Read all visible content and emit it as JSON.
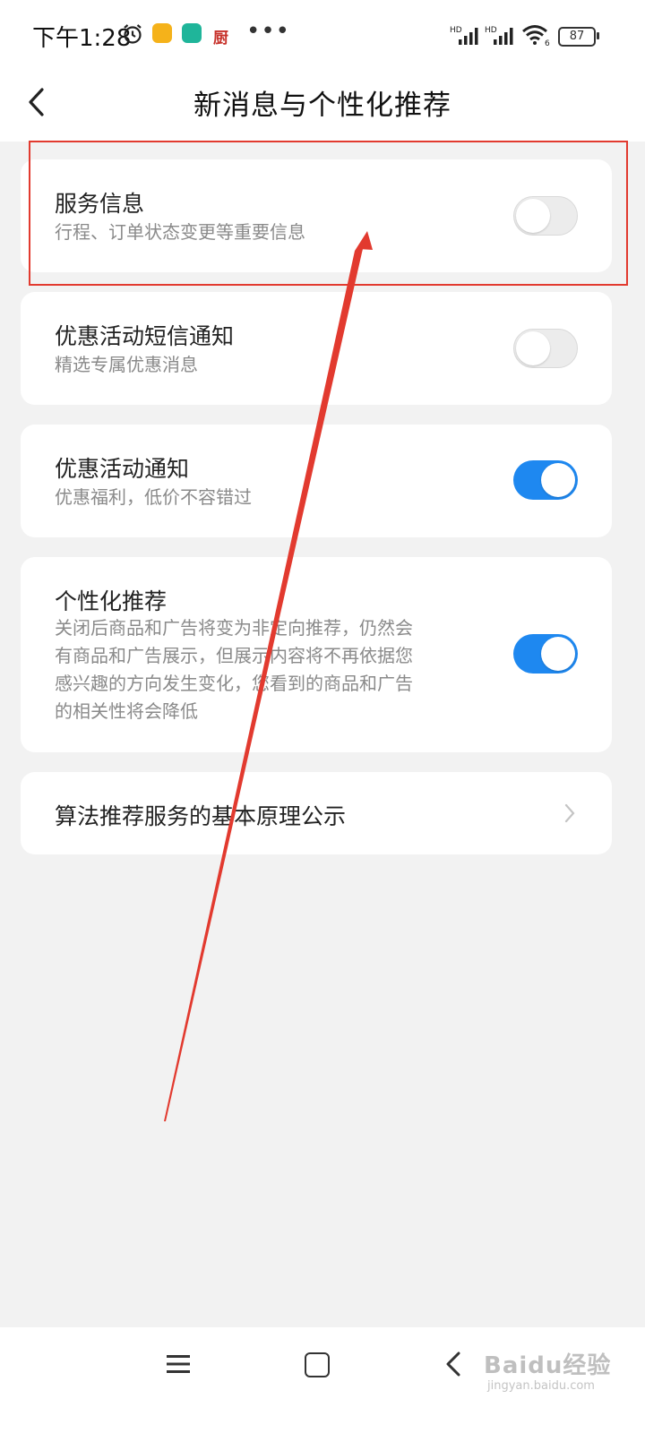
{
  "status_bar": {
    "time": "下午1:28",
    "app_badge": "厨",
    "more": "•••",
    "signal1_label": "HD",
    "signal2_label": "HD",
    "wifi_label": "6",
    "battery": "87"
  },
  "header": {
    "title": "新消息与个性化推荐"
  },
  "settings": [
    {
      "title": "服务信息",
      "subtitle": "行程、订单状态变更等重要信息",
      "enabled": false
    },
    {
      "title": "优惠活动短信通知",
      "subtitle": "精选专属优惠消息",
      "enabled": false
    },
    {
      "title": "优惠活动通知",
      "subtitle": "优惠福利，低价不容错过",
      "enabled": true
    },
    {
      "title": "个性化推荐",
      "subtitle_lines": [
        "关闭后商品和广告将变为非定向推荐，仍然会",
        "有商品和广告展示，但展示内容将不再依据您",
        "感兴趣的方向发生变化，您看到的商品和广告",
        "的相关性将会降低"
      ],
      "enabled": true
    }
  ],
  "link_row": {
    "label": "算法推荐服务的基本原理公示"
  },
  "watermark": {
    "brand": "Baidu经验",
    "url": "jingyan.baidu.com"
  },
  "colors": {
    "accent": "#1e88f0",
    "annotation": "#e23a2f"
  }
}
